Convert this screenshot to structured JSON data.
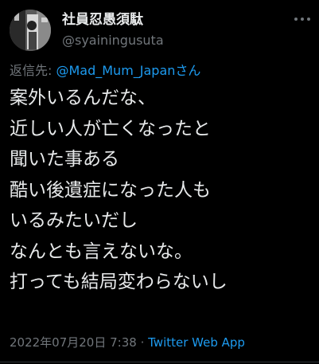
{
  "author": {
    "display_name": "社員忍愚須駄",
    "handle": "@syainingusuta"
  },
  "reply": {
    "prefix": "返信先: ",
    "mention": "@Mad_Mum_Japan",
    "suffix": "さん"
  },
  "tweet": {
    "lines": [
      "案外いるんだな、",
      "近しい人が亡くなったと",
      "聞いた事ある",
      "酷い後遺症になった人も",
      "いるみたいだし",
      "なんとも言えないな。",
      "打っても結局変わらないし"
    ],
    "timestamp": "2022年07月20日 7:38",
    "separator": " · ",
    "source": "Twitter Web App"
  },
  "icons": {
    "avatar": "avatar-photo",
    "more": "more-options-icon"
  },
  "colors": {
    "background": "#000000",
    "text": "#e7e9ea",
    "muted": "#71767b",
    "accent": "#1d9bf0"
  }
}
